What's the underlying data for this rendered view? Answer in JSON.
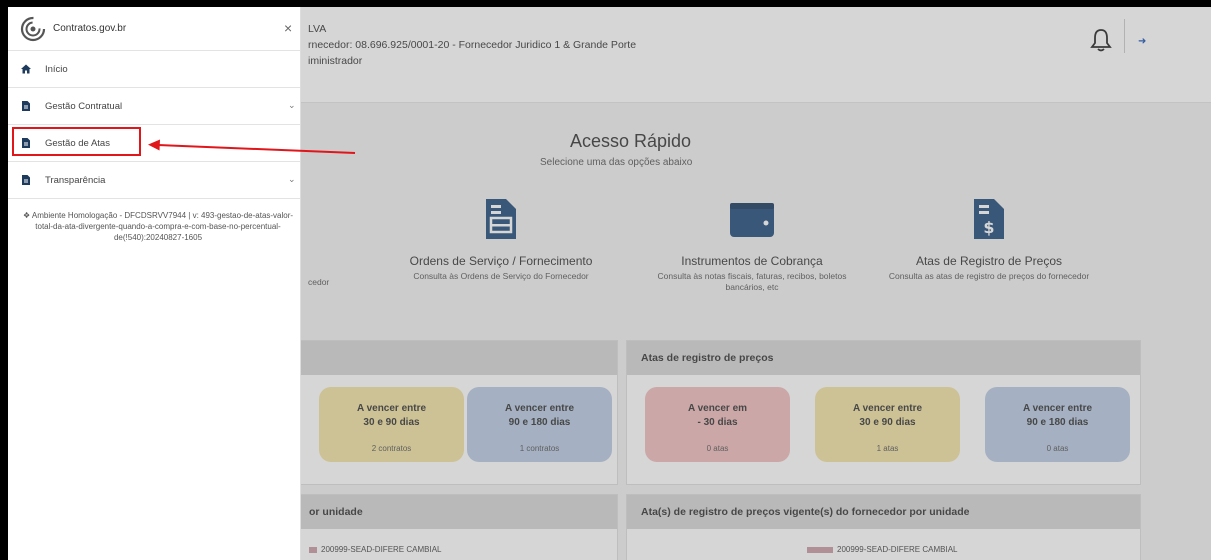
{
  "header": {
    "user_name_partial": "LVA",
    "supplier_line": "rnecedor: 08.696.925/0001-20 - Fornecedor Juridico 1 & Grande Porte",
    "role_line": "iministrador"
  },
  "quick_access": {
    "title": "Acesso Rápido",
    "subtitle": "Selecione uma das opções abaixo",
    "partial_left": "cedor",
    "cards": [
      {
        "title": "Ordens de Serviço / Fornecimento",
        "desc": "Consulta às Ordens de Serviço do Fornecedor",
        "icon": "document-icon"
      },
      {
        "title": "Instrumentos de Cobrança",
        "desc": "Consulta às notas fiscais, faturas, recibos, boletos bancários, etc",
        "icon": "wallet-icon"
      },
      {
        "title": "Atas de Registro de Preços",
        "desc": "Consulta as atas de registro de preços do fornecedor",
        "icon": "dollar-document-icon"
      }
    ]
  },
  "contracts_panel": {
    "tiles": [
      {
        "line1": "A vencer entre",
        "line2": "30 e 90 dias",
        "count": "2 contratos",
        "color": "#f3e3a3"
      },
      {
        "line1": "A vencer entre",
        "line2": "90 e 180 dias",
        "count": "1 contratos",
        "color": "#b9cbe3"
      }
    ]
  },
  "atas_panel": {
    "title": "Atas de registro de preços",
    "tiles": [
      {
        "line1": "A vencer em",
        "line2": "- 30 dias",
        "count": "0 atas",
        "color": "#f0bcbc"
      },
      {
        "line1": "A vencer entre",
        "line2": "30 e 90 dias",
        "count": "1 atas",
        "color": "#f3e3a3"
      },
      {
        "line1": "A vencer entre",
        "line2": "90 e 180 dias",
        "count": "0 atas",
        "color": "#b9cbe3"
      }
    ]
  },
  "bottom_panels": {
    "left_title_partial": "or unidade",
    "right_title": "Ata(s) de registro de preços vigente(s) do fornecedor por unidade",
    "legend_left": "200999-SEAD-DIFERE CAMBIAL",
    "legend_right": "200999-SEAD-DIFERE CAMBIAL"
  },
  "drawer": {
    "brand": "Contratos.gov.br",
    "close_glyph": "×",
    "items": [
      {
        "label": "Início",
        "icon": "home-icon",
        "has_chevron": false
      },
      {
        "label": "Gestão Contratual",
        "icon": "file-icon",
        "has_chevron": true
      },
      {
        "label": "Gestão de Atas",
        "icon": "file-icon",
        "has_chevron": false
      },
      {
        "label": "Transparência",
        "icon": "file-icon",
        "has_chevron": true
      }
    ],
    "chevron_glyph": "⌄",
    "environment_text": "❖ Ambiente Homologação - DFCDSRVV7944 | v: 493-gestao-de-atas-valor-total-da-ata-divergente-quando-a-compra-e-com-base-no-percentual-de(!540):20240827-1605"
  },
  "colors": {
    "annotation_red": "#e0161b",
    "brand_blue": "#1351b4",
    "icon_navy": "#1e4a7a"
  }
}
